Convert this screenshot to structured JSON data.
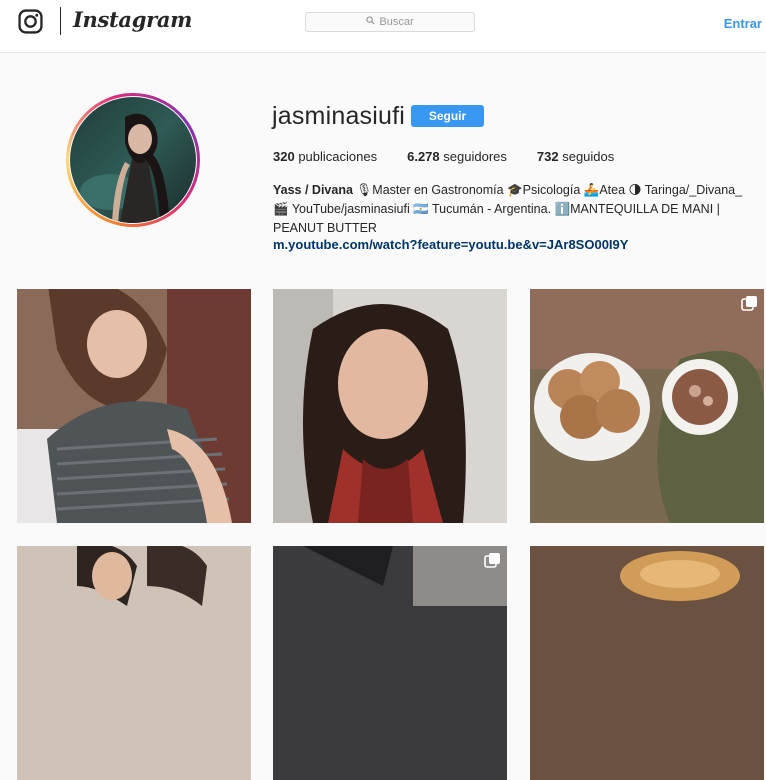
{
  "header": {
    "logo_icon": "instagram-camera-icon",
    "wordmark": "Instagram",
    "search_placeholder": "Buscar",
    "search_icon": "search-icon",
    "login_label": "Entrar"
  },
  "profile": {
    "username": "jasminasiufi",
    "follow_label": "Seguir",
    "posts_count": "320",
    "posts_label": "publicaciones",
    "followers_count": "6.278",
    "followers_label": "seguidores",
    "following_count": "732",
    "following_label": "seguidos",
    "bio_name": "Yass / Divana",
    "bio_text_1": "🎙Master en Gastronomía 🎓Psicología 🚣Atea 🌗 Taringa/_Divana_ 🎬",
    "bio_text_2": "YouTube/jasminasiufi 🇦🇷 Tucumán - Argentina. ℹ️MANTEQUILLA DE MANI | PEANUT BUTTER",
    "bio_link": "m.youtube.com/watch?feature=youtu.be&v=JAr8SO00I9Y"
  },
  "posts": [
    {
      "multi": false
    },
    {
      "multi": false
    },
    {
      "multi": true
    },
    {
      "multi": false
    },
    {
      "multi": true
    },
    {
      "multi": false
    }
  ],
  "colors": {
    "accent": "#3897f0",
    "link": "#003569",
    "text": "#262626",
    "background": "#fafafa"
  }
}
